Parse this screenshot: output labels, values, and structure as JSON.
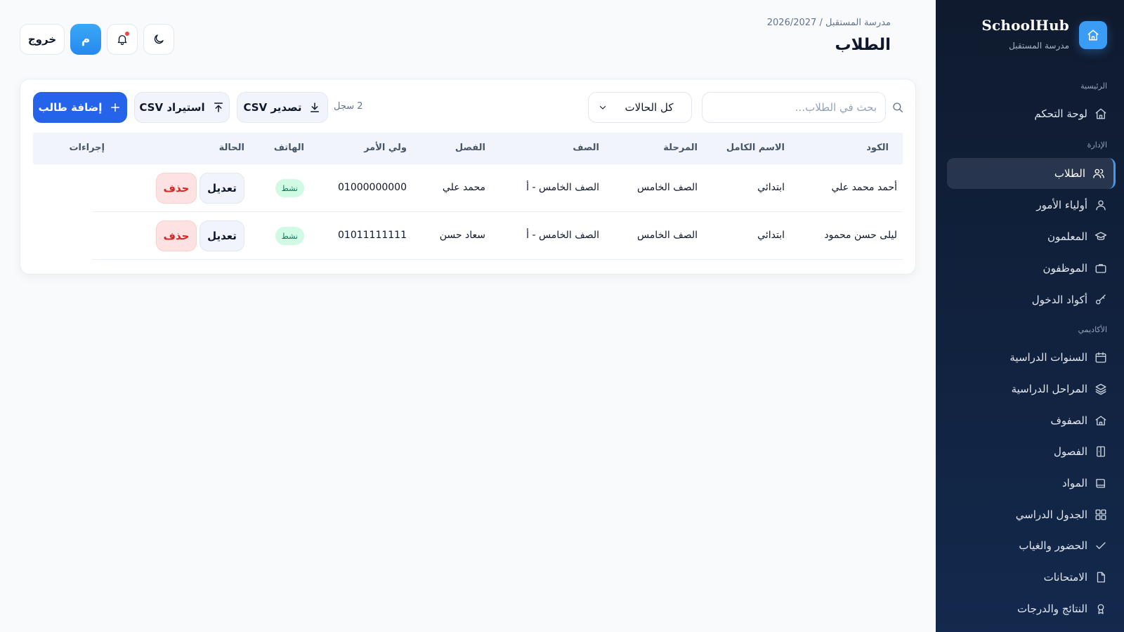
{
  "app": {
    "name": "SchoolHub",
    "school": "مدرسة المستقبل"
  },
  "header": {
    "breadcrumb": "مدرسة المستقبل / 2026/2027",
    "title": "الطلاب",
    "logout_label": "خروج",
    "avatar_initial": "م",
    "notification_dot_color": "#ef4444"
  },
  "sidebar": {
    "sections": {
      "home": "الرئيسية",
      "admin": "الإدارة",
      "academic": "الأكاديمي"
    },
    "items": [
      {
        "label": "لوحة التحكم",
        "icon": "home-icon"
      },
      {
        "label": "الطلاب",
        "icon": "users-icon",
        "active": true
      },
      {
        "label": "أولياء الأمور",
        "icon": "user-icon"
      },
      {
        "label": "المعلمون",
        "icon": "graduation-cap-icon"
      },
      {
        "label": "الموظفون",
        "icon": "briefcase-icon"
      },
      {
        "label": "أكواد الدخول",
        "icon": "key-icon"
      },
      {
        "label": "السنوات الدراسية",
        "icon": "calendar-icon"
      },
      {
        "label": "المراحل الدراسية",
        "icon": "layers-icon"
      },
      {
        "label": "الصفوف",
        "icon": "school-icon"
      },
      {
        "label": "الفصول",
        "icon": "door-icon"
      },
      {
        "label": "المواد",
        "icon": "book-icon"
      },
      {
        "label": "الجدول الدراسي",
        "icon": "grid-icon"
      },
      {
        "label": "الحضور والغياب",
        "icon": "check-icon"
      },
      {
        "label": "الامتحانات",
        "icon": "file-icon"
      },
      {
        "label": "النتائج والدرجات",
        "icon": "award-icon"
      }
    ]
  },
  "toolbar": {
    "search_placeholder": "بحث في الطلاب...",
    "status_filter": "كل الحالات",
    "record_count": "2 سجل",
    "export_label": "تصدير CSV",
    "import_label": "استيراد CSV",
    "add_label": "إضافة طالب"
  },
  "table": {
    "columns": [
      "الكود",
      "الاسم الكامل",
      "المرحلة",
      "الصف",
      "الفصل",
      "ولي الأمر",
      "الهاتف",
      "الحالة",
      "إجراءات"
    ],
    "rows": [
      {
        "name": "أحمد محمد علي",
        "stage": "ابتدائي",
        "grade": "الصف الخامس",
        "class": "الصف الخامس - أ",
        "guardian": "محمد علي",
        "phone": "01000000000",
        "status": "نشط",
        "edit": "تعديل",
        "delete": "حذف"
      },
      {
        "name": "ليلى حسن محمود",
        "stage": "ابتدائي",
        "grade": "الصف الخامس",
        "class": "الصف الخامس - أ",
        "guardian": "سعاد حسن",
        "phone": "01011111111",
        "status": "نشط",
        "edit": "تعديل",
        "delete": "حذف"
      }
    ]
  },
  "colors": {
    "primary": "#2563eb",
    "sidebar_bg": "#0f1a2e",
    "accent": "#3b9cf5",
    "status_active_bg": "#d1fae5",
    "delete_bg": "#fde2e2"
  }
}
